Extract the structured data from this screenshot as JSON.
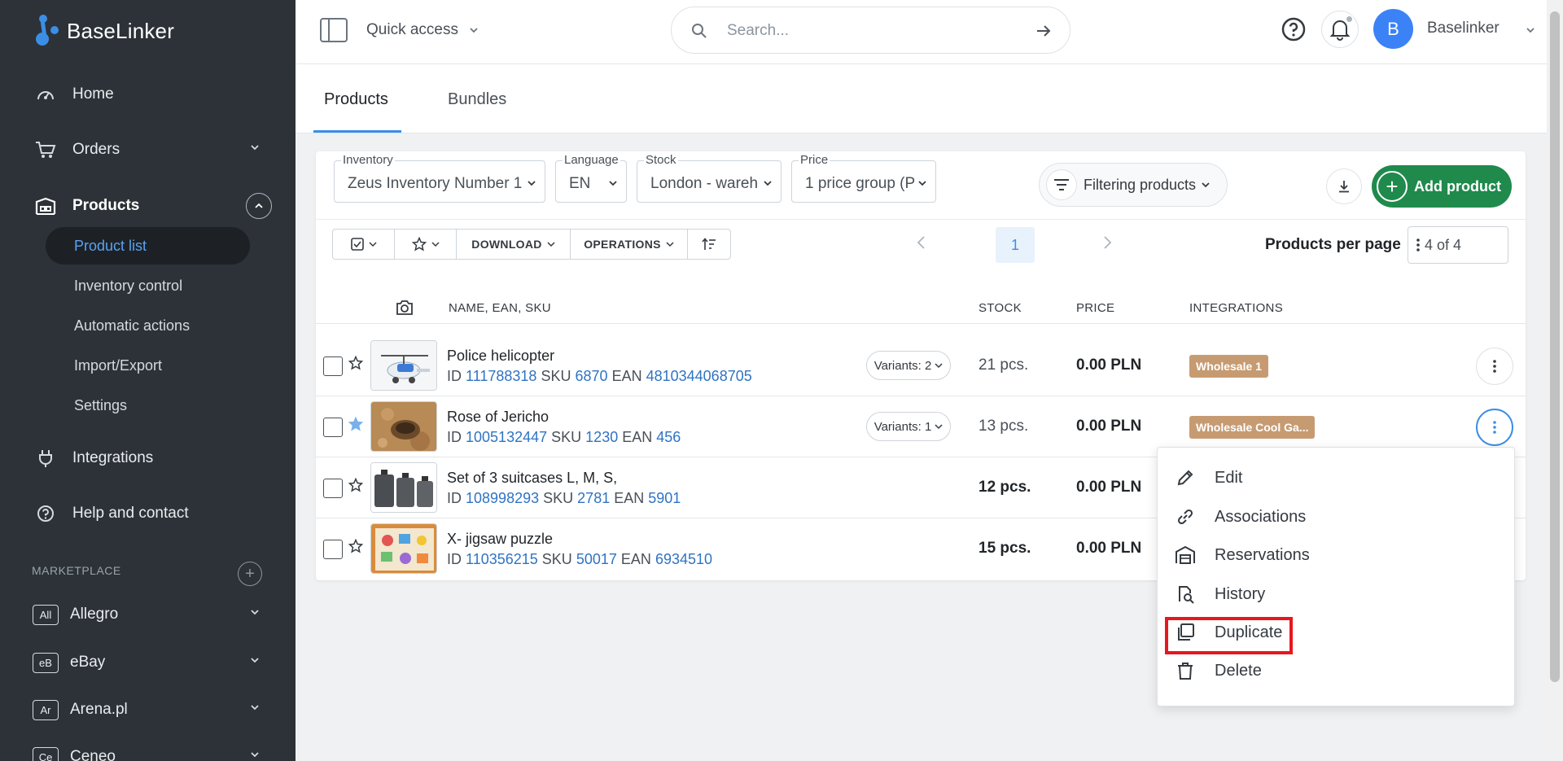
{
  "sidebar": {
    "logo": "BaseLinker",
    "nav": [
      {
        "label": "Home",
        "icon": "dashboard-icon"
      },
      {
        "label": "Orders",
        "icon": "cart-icon"
      },
      {
        "label": "Products",
        "icon": "warehouse-icon"
      },
      {
        "label": "Integrations",
        "icon": "plug-icon"
      },
      {
        "label": "Help and contact",
        "icon": "help-circle-icon"
      }
    ],
    "products_sub": [
      "Product list",
      "Inventory control",
      "Automatic actions",
      "Import/Export",
      "Settings"
    ],
    "marketplace_label": "MARKETPLACE",
    "marketplaces": [
      {
        "badge": "All",
        "label": "Allegro"
      },
      {
        "badge": "eB",
        "label": "eBay"
      },
      {
        "badge": "Ar",
        "label": "Arena.pl"
      },
      {
        "badge": "Ce",
        "label": "Ceneo"
      }
    ]
  },
  "topbar": {
    "quick_access": "Quick access",
    "search_placeholder": "Search...",
    "avatar_letter": "B",
    "user_name": "Baselinker"
  },
  "tabs": [
    "Products",
    "Bundles"
  ],
  "filters": {
    "inventory": {
      "label": "Inventory",
      "value": "Zeus Inventory Number 1"
    },
    "language": {
      "label": "Language",
      "value": "EN"
    },
    "stock": {
      "label": "Stock",
      "value": "London - wareh"
    },
    "price": {
      "label": "Price",
      "value": "1 price group (P"
    },
    "filter_button": "Filtering products",
    "add_product": "Add product"
  },
  "toolbar": {
    "download": "DOWNLOAD",
    "operations": "OPERATIONS"
  },
  "pagination": {
    "current_page": "1",
    "per_page_label": "Products per page",
    "per_page_value": "4 of 4"
  },
  "table": {
    "headers": [
      "NAME, EAN, SKU",
      "STOCK",
      "PRICE",
      "INTEGRATIONS"
    ],
    "rows": [
      {
        "name": "Police helicopter",
        "id_label": "ID",
        "id": "111788318",
        "sku_label": "SKU",
        "sku": "6870",
        "ean_label": "EAN",
        "ean": "4810344068705",
        "variants": "Variants: 2",
        "stock": "21 pcs.",
        "price": "0.00 PLN",
        "integration": "Wholesale 1",
        "starred": false
      },
      {
        "name": "Rose of Jericho",
        "id_label": "ID",
        "id": "1005132447",
        "sku_label": "SKU",
        "sku": "1230",
        "ean_label": "EAN",
        "ean": "456",
        "variants": "Variants: 1",
        "stock": "13 pcs.",
        "price": "0.00 PLN",
        "integration": "Wholesale Cool Ga...",
        "starred": true
      },
      {
        "name": "Set of 3 suitcases L, M, S,",
        "id_label": "ID",
        "id": "108998293",
        "sku_label": "SKU",
        "sku": "2781",
        "ean_label": "EAN",
        "ean": "5901",
        "variants": "",
        "stock": "12 pcs.",
        "price": "0.00 PLN",
        "integration": "",
        "starred": false
      },
      {
        "name": "X- jigsaw puzzle",
        "id_label": "ID",
        "id": "110356215",
        "sku_label": "SKU",
        "sku": "50017",
        "ean_label": "EAN",
        "ean": "6934510",
        "variants": "",
        "stock": "15 pcs.",
        "price": "0.00 PLN",
        "integration": "",
        "starred": false
      }
    ]
  },
  "context_menu": {
    "items": [
      {
        "label": "Edit",
        "icon": "pencil-icon"
      },
      {
        "label": "Associations",
        "icon": "link-icon"
      },
      {
        "label": "Reservations",
        "icon": "reservation-icon"
      },
      {
        "label": "History",
        "icon": "history-icon"
      },
      {
        "label": "Duplicate",
        "icon": "duplicate-icon"
      },
      {
        "label": "Delete",
        "icon": "trash-icon"
      }
    ],
    "highlighted": "Duplicate"
  },
  "colors": {
    "sidebar_bg": "#2c3238",
    "accent": "#3b8ee6",
    "add_button": "#1f8a4c",
    "integration_badge": "#c79b72",
    "highlight_border": "#e8161d"
  }
}
